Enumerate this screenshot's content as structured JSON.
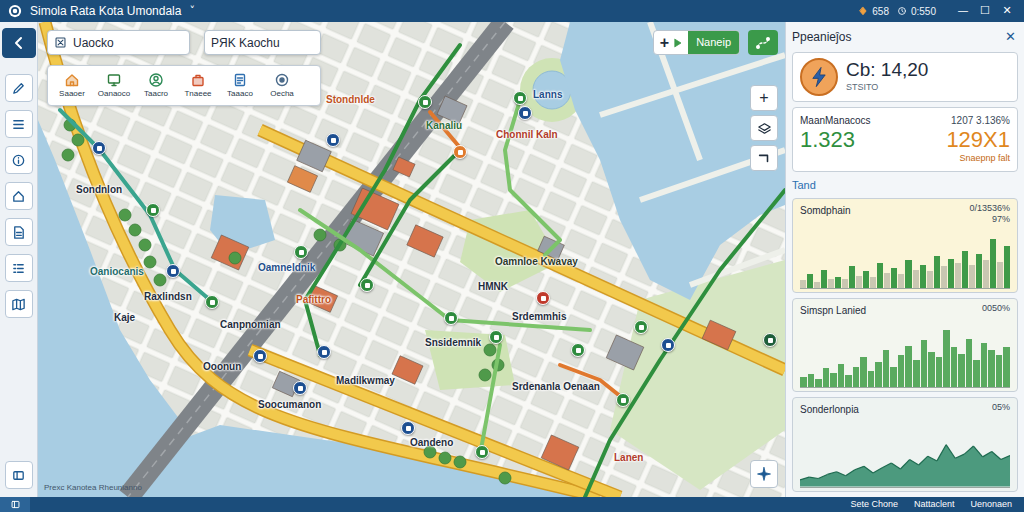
{
  "window": {
    "title": "Simola Rata Kota Umondala",
    "menu_glyph": "˅",
    "indicators": [
      "658",
      "0:550"
    ],
    "controls": [
      "—",
      "☐",
      "✕"
    ]
  },
  "map": {
    "search": [
      {
        "value": "Uaocko"
      },
      {
        "value": "PЯK Kaochu"
      }
    ],
    "tools": [
      {
        "label": "Saaoer",
        "color": "#e0892e"
      },
      {
        "label": "Oanaoco",
        "color": "#2e7d3e"
      },
      {
        "label": "Taacro",
        "color": "#2e8b57"
      },
      {
        "label": "Tnaeee",
        "color": "#d0502a"
      },
      {
        "label": "Taaaco",
        "color": "#2f6fb0"
      },
      {
        "label": "Oecha",
        "color": "#4a6a8a"
      }
    ],
    "action": {
      "prefix": "+",
      "label": "Naneip"
    },
    "zoom_in": "+",
    "labels": [
      {
        "text": "Stondnlde",
        "color": "#c0531f"
      },
      {
        "text": "Kanaliu",
        "color": "#2d6e3a"
      },
      {
        "text": "Chonnil Kaln",
        "color": "#b13b2a"
      },
      {
        "text": "Lanns",
        "color": "#1f4f8a"
      },
      {
        "text": "Sondnlon",
        "color": "#1f2d3d"
      },
      {
        "text": "Oaniocanis",
        "color": "#1f6d6b"
      },
      {
        "text": "Raxlindsn",
        "color": "#1f2d3d"
      },
      {
        "text": "Kaje",
        "color": "#1f2d3d"
      },
      {
        "text": "Canpnomian",
        "color": "#1f2d3d"
      },
      {
        "text": "Ooonun",
        "color": "#1f2d3d"
      },
      {
        "text": "Soocumanon",
        "color": "#1f2d3d"
      },
      {
        "text": "Oamnloe Kwavay",
        "color": "#2d3a2a"
      },
      {
        "text": "HMNK",
        "color": "#1f2d3d"
      },
      {
        "text": "Srdemmhis",
        "color": "#1f2d3d"
      },
      {
        "text": "Snsidemnik",
        "color": "#1f2d3d"
      },
      {
        "text": "Madilkwmay",
        "color": "#1f2d3d"
      },
      {
        "text": "Srdenanla Oenaan",
        "color": "#1f2d3d"
      },
      {
        "text": "Oandeno",
        "color": "#1f2d3d"
      },
      {
        "text": "Lanen",
        "color": "#b13b2a"
      },
      {
        "text": "Oamneldnik",
        "color": "#1f4f8a"
      },
      {
        "text": "Pafittro",
        "color": "#c0531f"
      }
    ],
    "pins": [
      {
        "color": "#2e8b3e"
      },
      {
        "color": "#2e8b3e"
      },
      {
        "color": "#1d4f91"
      },
      {
        "color": "#e07a2c"
      },
      {
        "color": "#1d4f91"
      },
      {
        "color": "#1d4f91"
      },
      {
        "color": "#2e8b3e"
      },
      {
        "color": "#2e8b3e"
      },
      {
        "color": "#2e8b3e"
      },
      {
        "color": "#1d4f91"
      },
      {
        "color": "#2e8b3e"
      },
      {
        "color": "#2e8b3e"
      },
      {
        "color": "#c0392b"
      },
      {
        "color": "#1d4f91"
      },
      {
        "color": "#1d4f91"
      },
      {
        "color": "#2e8b3e"
      },
      {
        "color": "#2e8b3e"
      },
      {
        "color": "#2e8b3e"
      },
      {
        "color": "#1d4f91"
      },
      {
        "color": "#1e5e3a"
      },
      {
        "color": "#2e8b3e"
      },
      {
        "color": "#1d4f91"
      },
      {
        "color": "#2e8b3e"
      },
      {
        "color": "#1d4f91"
      }
    ],
    "routes": [
      {
        "color": "#2f8f3e"
      },
      {
        "color": "#2f8f3e"
      },
      {
        "color": "#7cc46a"
      },
      {
        "color": "#7cc46a"
      },
      {
        "color": "#e0782e"
      },
      {
        "color": "#e0782e"
      },
      {
        "color": "#3aa58f"
      },
      {
        "color": "#2f8f3e"
      },
      {
        "color": "#7cc46a"
      }
    ],
    "attribution": "Prexc Kanotea Rheunianno"
  },
  "panel": {
    "title": "Ppeanieĵos",
    "close": "✕",
    "summary": {
      "value": "Cb: 14,20",
      "caption": "STSITO"
    },
    "metrics": {
      "title": "MaanManacocs",
      "meta": "1207 3.136%",
      "primary": "1.323",
      "secondary": "129X1",
      "note": "Snaepnp falt"
    },
    "section": "Tand",
    "charts": [
      {
        "title": "Somdphain",
        "reading": "0/13536%",
        "sub": "97%",
        "kind": "bars",
        "series": [
          {
            "color": "#c9c7b2",
            "values": [
              12,
              10,
              15,
              14,
              20,
              18,
              25,
              22,
              30,
              28,
              35,
              40,
              38,
              45,
              42
            ]
          },
          {
            "color": "#3f9a48",
            "values": [
              22,
              30,
              18,
              35,
              28,
              40,
              33,
              45,
              38,
              52,
              48,
              60,
              55,
              80,
              68
            ]
          }
        ]
      },
      {
        "title": "Simspn Lanied",
        "reading": "0050%",
        "kind": "bars",
        "series": [
          {
            "color": "#5aaa5f",
            "values": [
              15,
              20,
              12,
              28,
              22,
              35,
              18,
              30,
              45,
              25,
              38,
              55,
              30,
              48,
              62,
              40,
              70,
              52,
              45,
              85,
              60,
              50,
              72,
              40,
              65,
              55,
              48,
              60
            ]
          }
        ]
      },
      {
        "title": "Sonderlonpia",
        "reading": "05%",
        "kind": "area",
        "series": [
          {
            "color": "#2f8a6a",
            "values": [
              10,
              14,
              12,
              18,
              22,
              16,
              25,
              30,
              20,
              28,
              35,
              26,
              40,
              32,
              45,
              38,
              62,
              42,
              48,
              60,
              44,
              52,
              40,
              46
            ]
          }
        ]
      }
    ]
  },
  "status_bar": {
    "items": [
      "Sete Chone",
      "Nattaclent",
      "Uenonaen"
    ]
  }
}
